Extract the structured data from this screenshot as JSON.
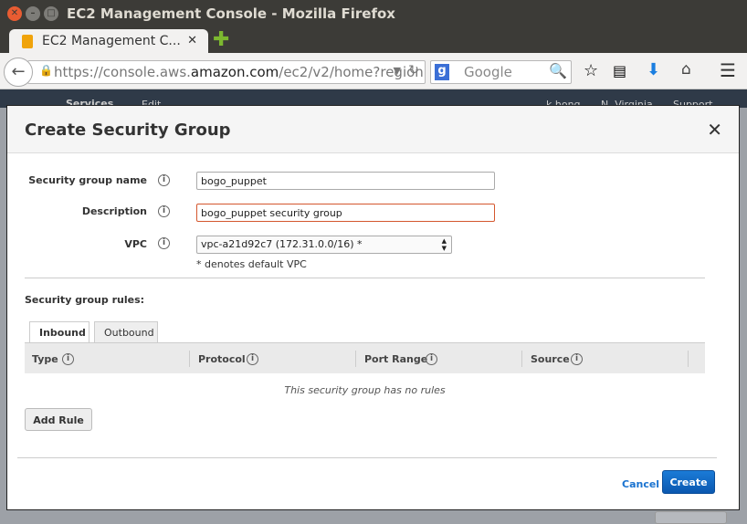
{
  "window": {
    "title": "EC2 Management Console - Mozilla Firefox"
  },
  "browser": {
    "tab_title": "EC2 Management C...",
    "url_prefix": "https://console.aws.",
    "url_domain": "amazon.com",
    "url_path": "/ec2/v2/home?region",
    "search_placeholder": "Google"
  },
  "aws": {
    "services": "Services",
    "edit": "Edit",
    "user": "k.hong",
    "region": "N. Virginia",
    "support": "Support"
  },
  "dialog": {
    "title": "Create Security Group",
    "fields": {
      "name_label": "Security group name",
      "name_value": "bogo_puppet",
      "desc_label": "Description",
      "desc_value": "bogo_puppet security group",
      "vpc_label": "VPC",
      "vpc_value": "vpc-a21d92c7 (172.31.0.0/16) *",
      "vpc_note": "* denotes default VPC"
    },
    "rules_label": "Security group rules:",
    "tabs": [
      "Inbound",
      "Outbound"
    ],
    "columns": [
      "Type",
      "Protocol",
      "Port Range",
      "Source"
    ],
    "empty": "This security group has no rules",
    "add_rule": "Add Rule",
    "cancel": "Cancel",
    "create": "Create"
  },
  "colors": {
    "primary": "#1066c2",
    "error_border": "#d4572e"
  }
}
